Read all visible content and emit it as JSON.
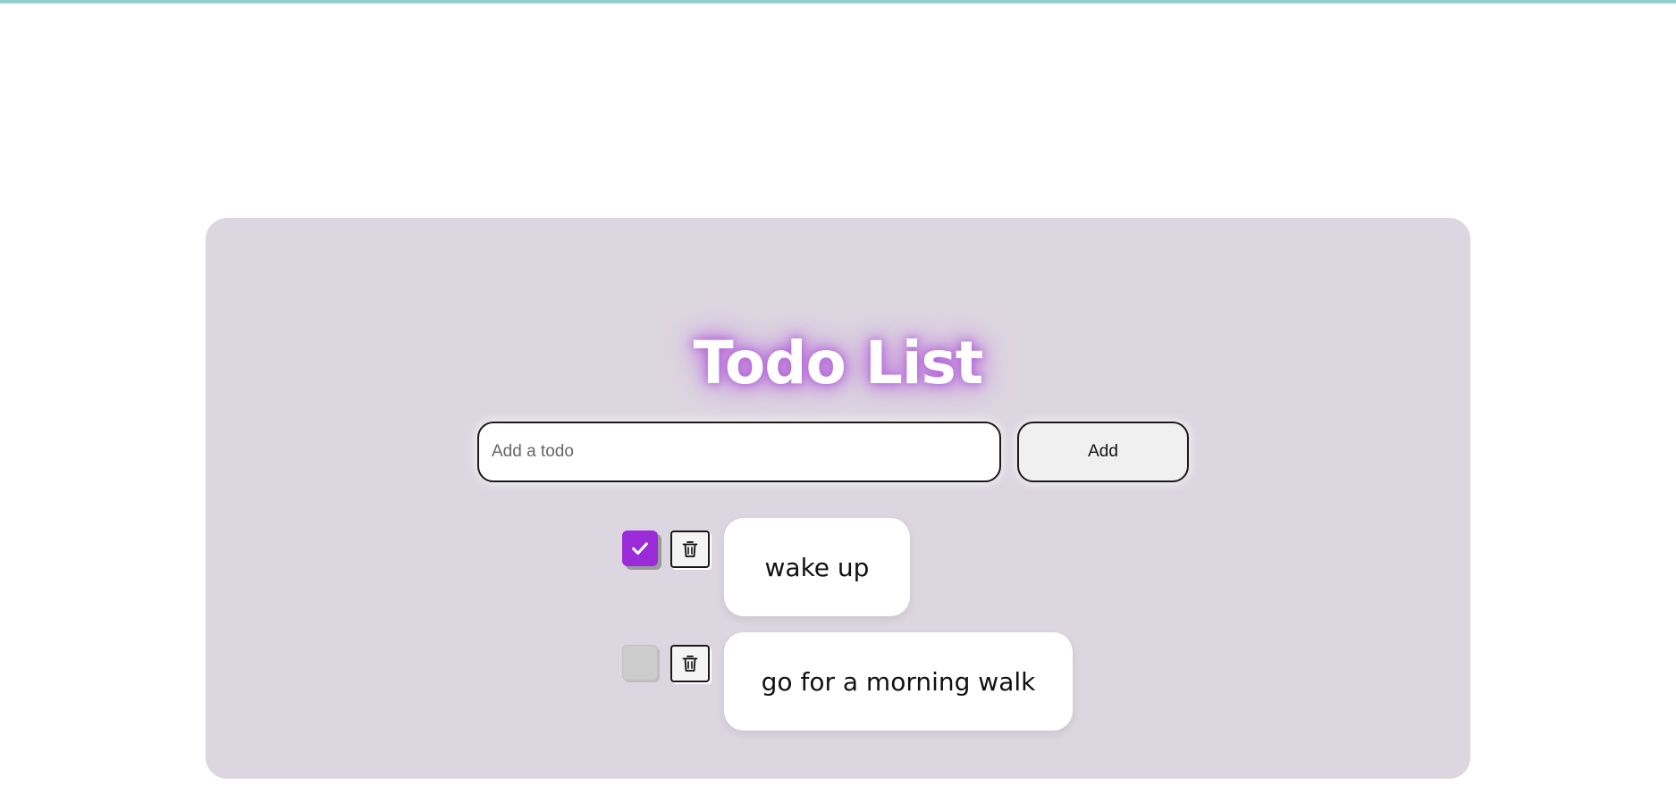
{
  "app": {
    "title": "Todo List"
  },
  "colors": {
    "accent": "#9b2bd8",
    "card_background": "#dcd6e0",
    "title_glow": "#b86ad8",
    "top_accent": "#8fcfcf"
  },
  "form": {
    "input_value": "",
    "input_placeholder": "Add a todo",
    "add_label": "Add"
  },
  "todos": [
    {
      "text": "wake up",
      "completed": true,
      "check_icon": "check-icon",
      "delete_icon": "trash-icon"
    },
    {
      "text": "go for a morning walk",
      "completed": false,
      "check_icon": "",
      "delete_icon": "trash-icon"
    }
  ]
}
